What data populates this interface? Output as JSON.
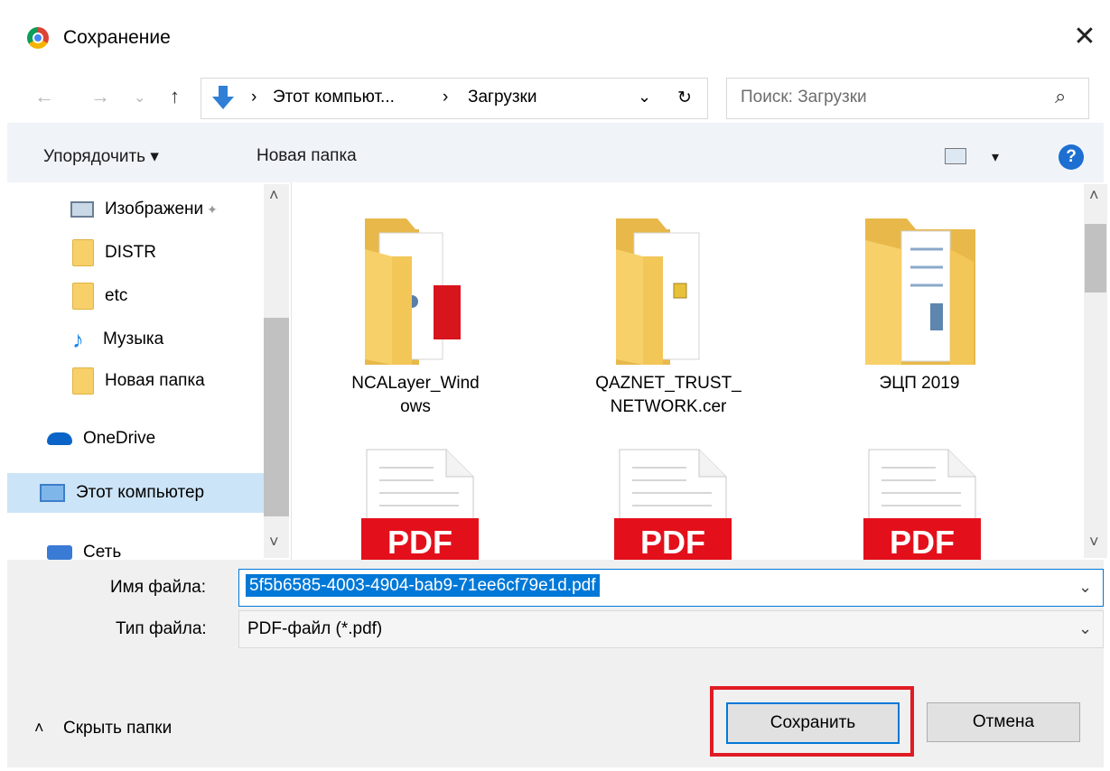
{
  "window": {
    "title": "Сохранение",
    "close": "✕"
  },
  "nav": {
    "back": "←",
    "forward": "→",
    "recent": "⌄",
    "up": "↑"
  },
  "address": {
    "crumb1": "Этот компьют...",
    "sep1": "›",
    "sep2": "›",
    "crumb2": "Загрузки",
    "dropdown": "⌄",
    "refresh": "↻"
  },
  "search": {
    "placeholder": "Поиск: Загрузки",
    "icon": "⌕"
  },
  "toolbar": {
    "organize": "Упорядочить ▾",
    "new_folder": "Новая папка",
    "view_arrow": "▾",
    "help": "?"
  },
  "sidebar": {
    "items": [
      {
        "label": "Изображени",
        "icon": "pictures-icon",
        "pin": "📌"
      },
      {
        "label": "DISTR",
        "icon": "folder-icon"
      },
      {
        "label": "etc",
        "icon": "folder-icon"
      },
      {
        "label": "Музыка",
        "icon": "music-icon"
      },
      {
        "label": "Новая папка",
        "icon": "folder-icon"
      },
      {
        "label": "OneDrive",
        "icon": "onedrive-icon"
      },
      {
        "label": "Этот компьютер",
        "icon": "computer-icon",
        "selected": true
      },
      {
        "label": "Сеть",
        "icon": "network-icon"
      }
    ],
    "scroll_up": "˄",
    "scroll_down": "˅"
  },
  "files": [
    {
      "name_line1": "NCALayer_Wind",
      "name_line2": "ows",
      "type": "folder"
    },
    {
      "name_line1": "QAZNET_TRUST_",
      "name_line2": "NETWORK.cer",
      "type": "folder"
    },
    {
      "name_line1": "ЭЦП 2019",
      "name_line2": "",
      "type": "folder"
    },
    {
      "name_line1": "",
      "type": "pdf",
      "badge": "PDF"
    },
    {
      "name_line1": "",
      "type": "pdf",
      "badge": "PDF"
    },
    {
      "name_line1": "",
      "type": "pdf",
      "badge": "PDF"
    }
  ],
  "content_scroll": {
    "up": "˄",
    "down": "˅"
  },
  "form": {
    "filename_label": "Имя файла:",
    "filename_value": "5f5b6585-4003-4904-bab9-71ee6cf79e1d.pdf",
    "filetype_label": "Тип файла:",
    "filetype_value": "PDF-файл (*.pdf)",
    "dropdown": "⌄"
  },
  "footer": {
    "hide_folders": "Скрыть папки",
    "hide_icon": "˄",
    "save": "Сохранить",
    "cancel": "Отмена"
  },
  "colors": {
    "accent": "#0078d7",
    "highlight_box": "#e01b24",
    "folder": "#f7d069",
    "pdf_red": "#e3101b"
  }
}
